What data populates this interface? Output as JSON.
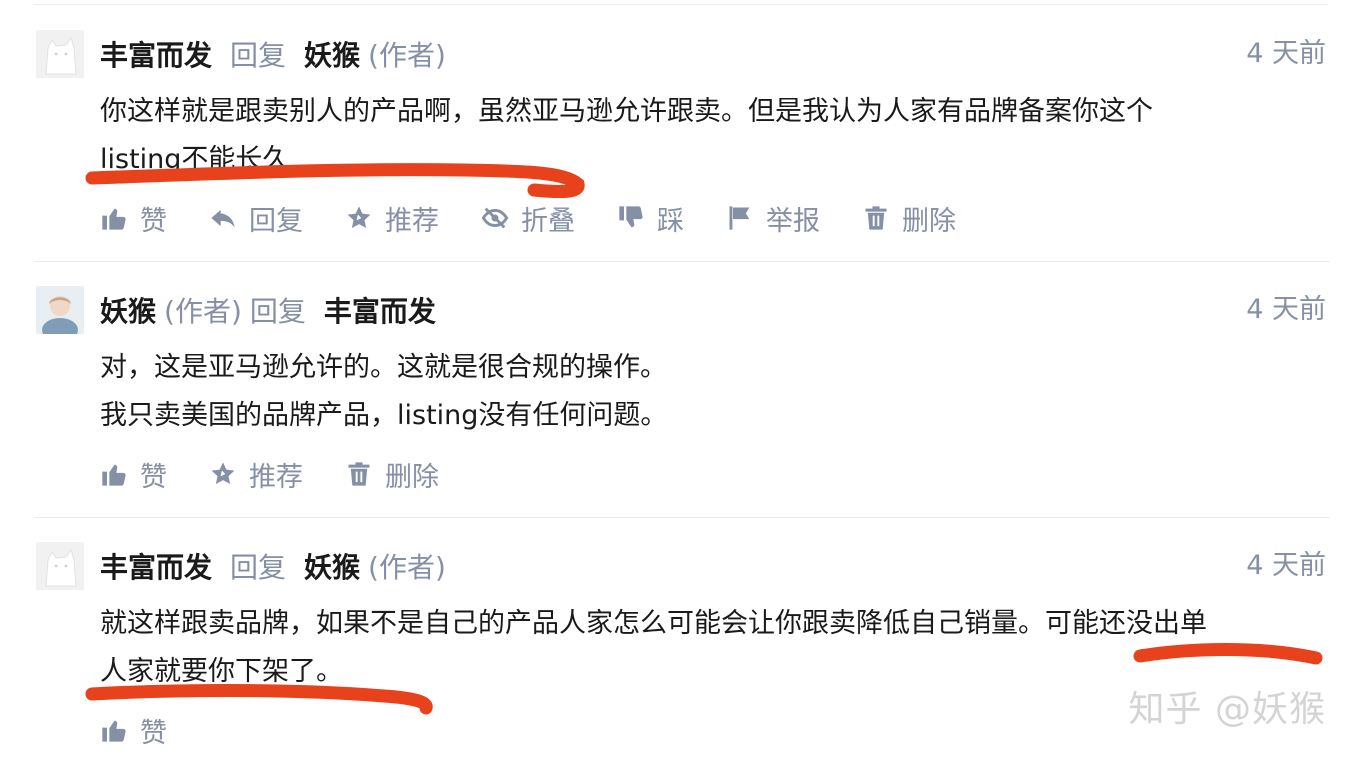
{
  "comments": [
    {
      "author": "丰富而发",
      "reply_word": "回复",
      "target": "妖猴",
      "target_tag": "(作者)",
      "time": "4 天前",
      "lines": [
        "你这样就是跟卖别人的产品啊，虽然亚马逊允许跟卖。但是我认为人家有品牌备案你这个",
        "listing不能长久"
      ],
      "actions": [
        "赞",
        "回复",
        "推荐",
        "折叠",
        "踩",
        "举报",
        "删除"
      ]
    },
    {
      "author": "妖猴",
      "author_tag": "(作者)",
      "reply_word": "回复",
      "target": "丰富而发",
      "time": "4 天前",
      "lines": [
        "对，这是亚马逊允许的。这就是很合规的操作。",
        "我只卖美国的品牌产品，listing没有任何问题。"
      ],
      "actions": [
        "赞",
        "推荐",
        "删除"
      ]
    },
    {
      "author": "丰富而发",
      "reply_word": "回复",
      "target": "妖猴",
      "target_tag": "(作者)",
      "time": "4 天前",
      "lines": [
        "就这样跟卖品牌，如果不是自己的产品人家怎么可能会让你跟卖降低自己销量。可能还没出单",
        "人家就要你下架了。"
      ],
      "actions": [
        "赞"
      ]
    }
  ],
  "watermark": "知乎 @妖猴",
  "colors": {
    "muted": "#8590a6",
    "highlight": "#e8421c",
    "text": "#1a1a1a"
  }
}
